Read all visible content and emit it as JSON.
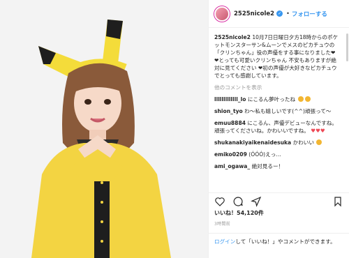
{
  "post": {
    "username": "2525nicole2",
    "follow_label": "フォローする",
    "caption_user": "2525nicole2",
    "caption_text": " 10月7日日曜日夕方18時からのポケットモンスターサン&ムーンでメスのピカチュウの「クリンちゃん」役の声優をする事になりました❤︎❤︎とっても可愛いクリンちゃん 不安もありますが絶対に見てください ❤︎初の声優が大好きなピカチュウでとっても感謝しています。",
    "more_comments": "他のコメントを表示"
  },
  "comments": [
    {
      "user": "lllllllllllll_lo",
      "text": " にこるん夢叶ったね"
    },
    {
      "user": "shion_tyo",
      "text": " わ〜私も嬉しいです(^^)頑張って〜"
    },
    {
      "user": "emuu8884",
      "text": " にこるん、声優デビューなんですね。頑張ってくださいね。かわいいですね。"
    },
    {
      "user": "shukanakiyaikenaidesuka",
      "text": " かわいい"
    },
    {
      "user": "emiko0209",
      "text": " (ÓÓÓ)えっ…"
    },
    {
      "user": "ami_ogawa_",
      "text": " 絶対見るー！"
    }
  ],
  "likes": "いいね！54,120件",
  "posted": "3時間前",
  "login": {
    "prefix": "",
    "link": "ログイン",
    "suffix": "して「いいね！」やコメントができます。"
  },
  "icons": [
    "heart-icon",
    "comment-icon",
    "share-icon",
    "bookmark-icon",
    "verified-icon"
  ]
}
